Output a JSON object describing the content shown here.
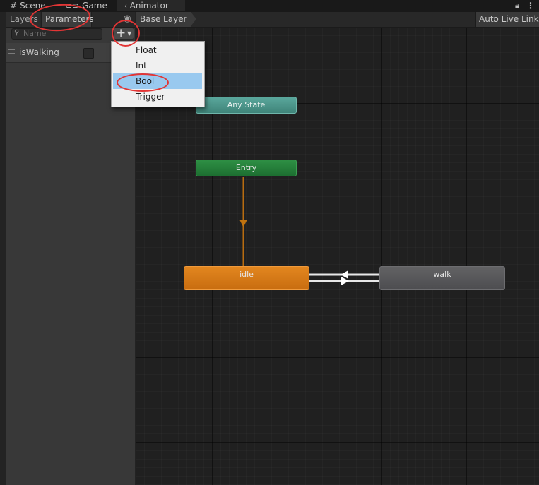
{
  "window_tabs": [
    {
      "label": "Scene",
      "icon": "grid-icon"
    },
    {
      "label": "Game",
      "icon": "gamepad-icon"
    },
    {
      "label": "Animator",
      "icon": "animator-icon",
      "active": true
    }
  ],
  "left_panel": {
    "tabs": [
      {
        "label": "Layers"
      },
      {
        "label": "Parameters",
        "active": true
      }
    ],
    "search": {
      "value": "",
      "placeholder": "Name"
    },
    "parameters": [
      {
        "name": "isWalking",
        "type": "Bool",
        "checked": false
      }
    ]
  },
  "breadcrumb": {
    "layer": "Base Layer"
  },
  "toolbar": {
    "live_link": "Auto Live Link"
  },
  "add_menu": {
    "items": [
      {
        "label": "Float"
      },
      {
        "label": "Int"
      },
      {
        "label": "Bool",
        "highlighted": true
      },
      {
        "label": "Trigger"
      }
    ]
  },
  "graph": {
    "nodes": [
      {
        "id": "any",
        "label": "Any State",
        "color": "#4f9a8f"
      },
      {
        "id": "entry",
        "label": "Entry",
        "color": "#22803a"
      },
      {
        "id": "idle",
        "label": "idle",
        "color": "#d97a17",
        "default": true
      },
      {
        "id": "walk",
        "label": "walk",
        "color": "#58585b"
      }
    ],
    "transitions": [
      {
        "from": "entry",
        "to": "idle"
      },
      {
        "from": "idle",
        "to": "walk"
      },
      {
        "from": "walk",
        "to": "idle"
      }
    ]
  },
  "colors": {
    "annotation": "#e23535",
    "menu_highlight": "#99c9ef",
    "active_tab_accent": "#3a79bb"
  }
}
